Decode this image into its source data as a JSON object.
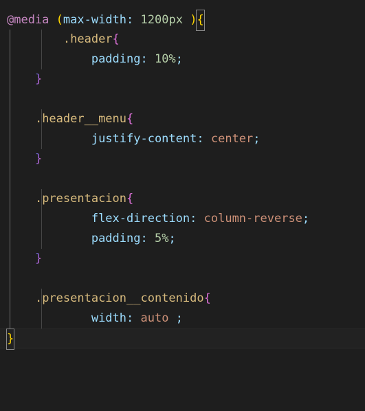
{
  "editor": {
    "language": "css",
    "theme": "dark",
    "background_color": "#1e1e1e",
    "current_line_number": 17,
    "colors": {
      "atrule": "#c586c0",
      "property": "#9cdcfe",
      "number": "#b5cea8",
      "selector": "#d7ba7d",
      "keyword": "#ce9178",
      "bracket_level1": "#ffd700",
      "bracket_level2": "#da70d6",
      "indent_guide_active": "#707070",
      "indent_guide": "#474747",
      "bracket_match_border": "#888888"
    }
  },
  "code": {
    "lines": [
      {
        "n": 1,
        "indent": 0,
        "tokens": [
          {
            "text": "@media",
            "type": "atrule"
          },
          {
            "text": " ",
            "type": "plain"
          },
          {
            "text": "(",
            "type": "paren"
          },
          {
            "text": "max-width",
            "type": "prop"
          },
          {
            "text": ":",
            "type": "punc"
          },
          {
            "text": " ",
            "type": "plain"
          },
          {
            "text": "1200px",
            "type": "num"
          },
          {
            "text": " ",
            "type": "plain"
          },
          {
            "text": ")",
            "type": "paren"
          },
          {
            "text": "{",
            "type": "bracket-match"
          }
        ]
      },
      {
        "n": 2,
        "indent": 2,
        "tokens": [
          {
            "text": ".header",
            "type": "selector"
          },
          {
            "text": "{",
            "type": "brace2"
          }
        ]
      },
      {
        "n": 3,
        "indent": 3,
        "tokens": [
          {
            "text": "padding",
            "type": "prop"
          },
          {
            "text": ":",
            "type": "punc"
          },
          {
            "text": " ",
            "type": "plain"
          },
          {
            "text": "10%",
            "type": "num"
          },
          {
            "text": ";",
            "type": "punc"
          }
        ]
      },
      {
        "n": 4,
        "indent": 1,
        "tokens": [
          {
            "text": "}",
            "type": "brace2g"
          }
        ]
      },
      {
        "n": 5,
        "indent": 0,
        "tokens": []
      },
      {
        "n": 6,
        "indent": 1,
        "tokens": [
          {
            "text": ".header__menu",
            "type": "selector"
          },
          {
            "text": "{",
            "type": "brace2"
          }
        ]
      },
      {
        "n": 7,
        "indent": 3,
        "tokens": [
          {
            "text": "justify-content",
            "type": "prop"
          },
          {
            "text": ":",
            "type": "punc"
          },
          {
            "text": " ",
            "type": "plain"
          },
          {
            "text": "center",
            "type": "keyword"
          },
          {
            "text": ";",
            "type": "punc"
          }
        ]
      },
      {
        "n": 8,
        "indent": 1,
        "tokens": [
          {
            "text": "}",
            "type": "brace2g"
          }
        ]
      },
      {
        "n": 9,
        "indent": 0,
        "tokens": []
      },
      {
        "n": 10,
        "indent": 1,
        "tokens": [
          {
            "text": ".presentacion",
            "type": "selector"
          },
          {
            "text": "{",
            "type": "brace2"
          }
        ]
      },
      {
        "n": 11,
        "indent": 3,
        "tokens": [
          {
            "text": "flex-direction",
            "type": "prop"
          },
          {
            "text": ":",
            "type": "punc"
          },
          {
            "text": " ",
            "type": "plain"
          },
          {
            "text": "column-reverse",
            "type": "keyword"
          },
          {
            "text": ";",
            "type": "punc"
          }
        ]
      },
      {
        "n": 12,
        "indent": 3,
        "tokens": [
          {
            "text": "padding",
            "type": "prop"
          },
          {
            "text": ":",
            "type": "punc"
          },
          {
            "text": " ",
            "type": "plain"
          },
          {
            "text": "5%",
            "type": "num"
          },
          {
            "text": ";",
            "type": "punc"
          }
        ]
      },
      {
        "n": 13,
        "indent": 1,
        "tokens": [
          {
            "text": "}",
            "type": "brace2g"
          }
        ]
      },
      {
        "n": 14,
        "indent": 0,
        "tokens": []
      },
      {
        "n": 15,
        "indent": 1,
        "tokens": [
          {
            "text": ".presentacion__contenido",
            "type": "selector"
          },
          {
            "text": "{",
            "type": "brace2"
          }
        ]
      },
      {
        "n": 16,
        "indent": 3,
        "tokens": [
          {
            "text": "width",
            "type": "prop"
          },
          {
            "text": ":",
            "type": "punc"
          },
          {
            "text": " ",
            "type": "plain"
          },
          {
            "text": "auto",
            "type": "keyword"
          },
          {
            "text": " ",
            "type": "plain"
          },
          {
            "text": ";",
            "type": "punc"
          }
        ]
      },
      {
        "n": 17,
        "indent": 0,
        "current": true,
        "tokens": [
          {
            "text": "}",
            "type": "bracket-match"
          }
        ]
      }
    ]
  }
}
